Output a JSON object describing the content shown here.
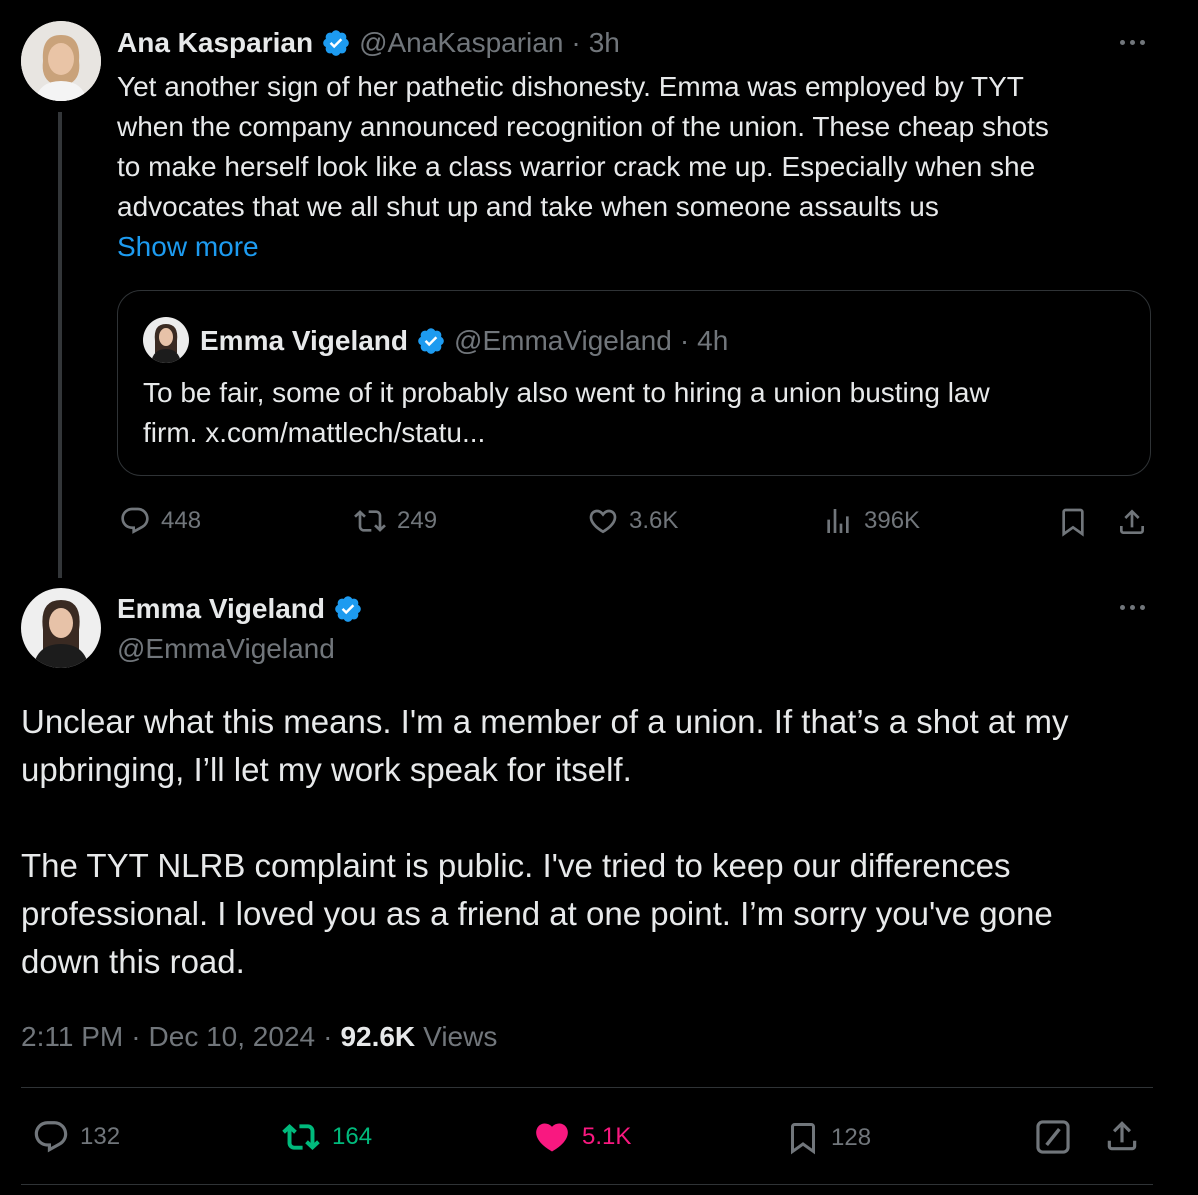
{
  "parent_tweet": {
    "author_name": "Ana Kasparian",
    "handle": "@AnaKasparian",
    "separator": "·",
    "time": "3h",
    "text_lines": [
      "Yet another sign of her pathetic dishonesty. Emma was employed by TYT",
      "when the company announced recognition of the union. These cheap shots",
      "to make herself look like a class warrior crack me up. Especially when she",
      "advocates that we all shut up and take when someone assaults us"
    ],
    "show_more": "Show more",
    "quote": {
      "author_name": "Emma Vigeland",
      "handle": "@EmmaVigeland",
      "separator": "·",
      "time": "4h",
      "text_lines": [
        "To be fair, some of it probably also went to hiring a union busting law",
        "firm. x.com/mattlech/statu..."
      ]
    },
    "actions": {
      "replies": "448",
      "reposts": "249",
      "likes": "3.6K",
      "views": "396K"
    }
  },
  "main_tweet": {
    "author_name": "Emma Vigeland",
    "handle": "@EmmaVigeland",
    "paragraph1_lines": [
      "Unclear what this means. I'm a member of a union. If that’s a shot at my",
      "upbringing, I’ll let my work speak for itself."
    ],
    "paragraph2_lines": [
      "The TYT NLRB complaint is public. I've tried to keep our differences",
      "professional. I loved you as a friend at one point. I’m sorry you've gone",
      "down this road."
    ],
    "meta": {
      "time": "2:11 PM",
      "sep1": "·",
      "date": "Dec 10, 2024",
      "sep2": "·",
      "views_count": "92.6K",
      "views_label": "Views"
    },
    "actions": {
      "replies": "132",
      "reposts": "164",
      "likes": "5.1K",
      "bookmarks": "128"
    }
  },
  "colors": {
    "background": "#000000",
    "text": "#e7e9ea",
    "muted": "#71767b",
    "link": "#1d9bf0",
    "verified": "#1d9bf0",
    "repost_active": "#00ba7c",
    "like_active": "#f91880",
    "border": "#2f3336"
  },
  "icons": [
    "verified-badge-icon",
    "more-icon",
    "reply-icon",
    "repost-icon",
    "like-icon",
    "views-icon",
    "bookmark-icon",
    "share-icon",
    "grok-icon"
  ]
}
